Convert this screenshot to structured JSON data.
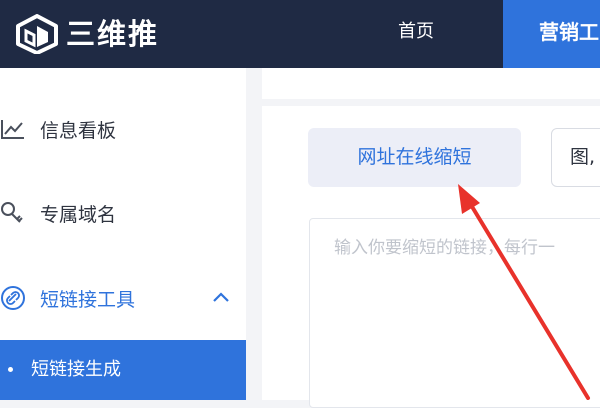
{
  "header": {
    "brand": "三维推",
    "nav": {
      "home": "首页",
      "active": "营销工"
    }
  },
  "sidebar": {
    "items": [
      {
        "label": "信息看板",
        "icon": "chart-icon"
      },
      {
        "label": "专属域名",
        "icon": "domain-icon"
      },
      {
        "label": "短链接工具",
        "icon": "link-icon",
        "expanded": true
      }
    ],
    "sub_item": "短链接生成"
  },
  "main": {
    "tabs": [
      "网址在线缩短",
      "图,"
    ],
    "input_placeholder": "输入你要缩短的链接，每行一"
  },
  "colors": {
    "header_bg": "#1f2a44",
    "accent": "#2f73dc",
    "annotation_arrow": "#e8322b"
  }
}
